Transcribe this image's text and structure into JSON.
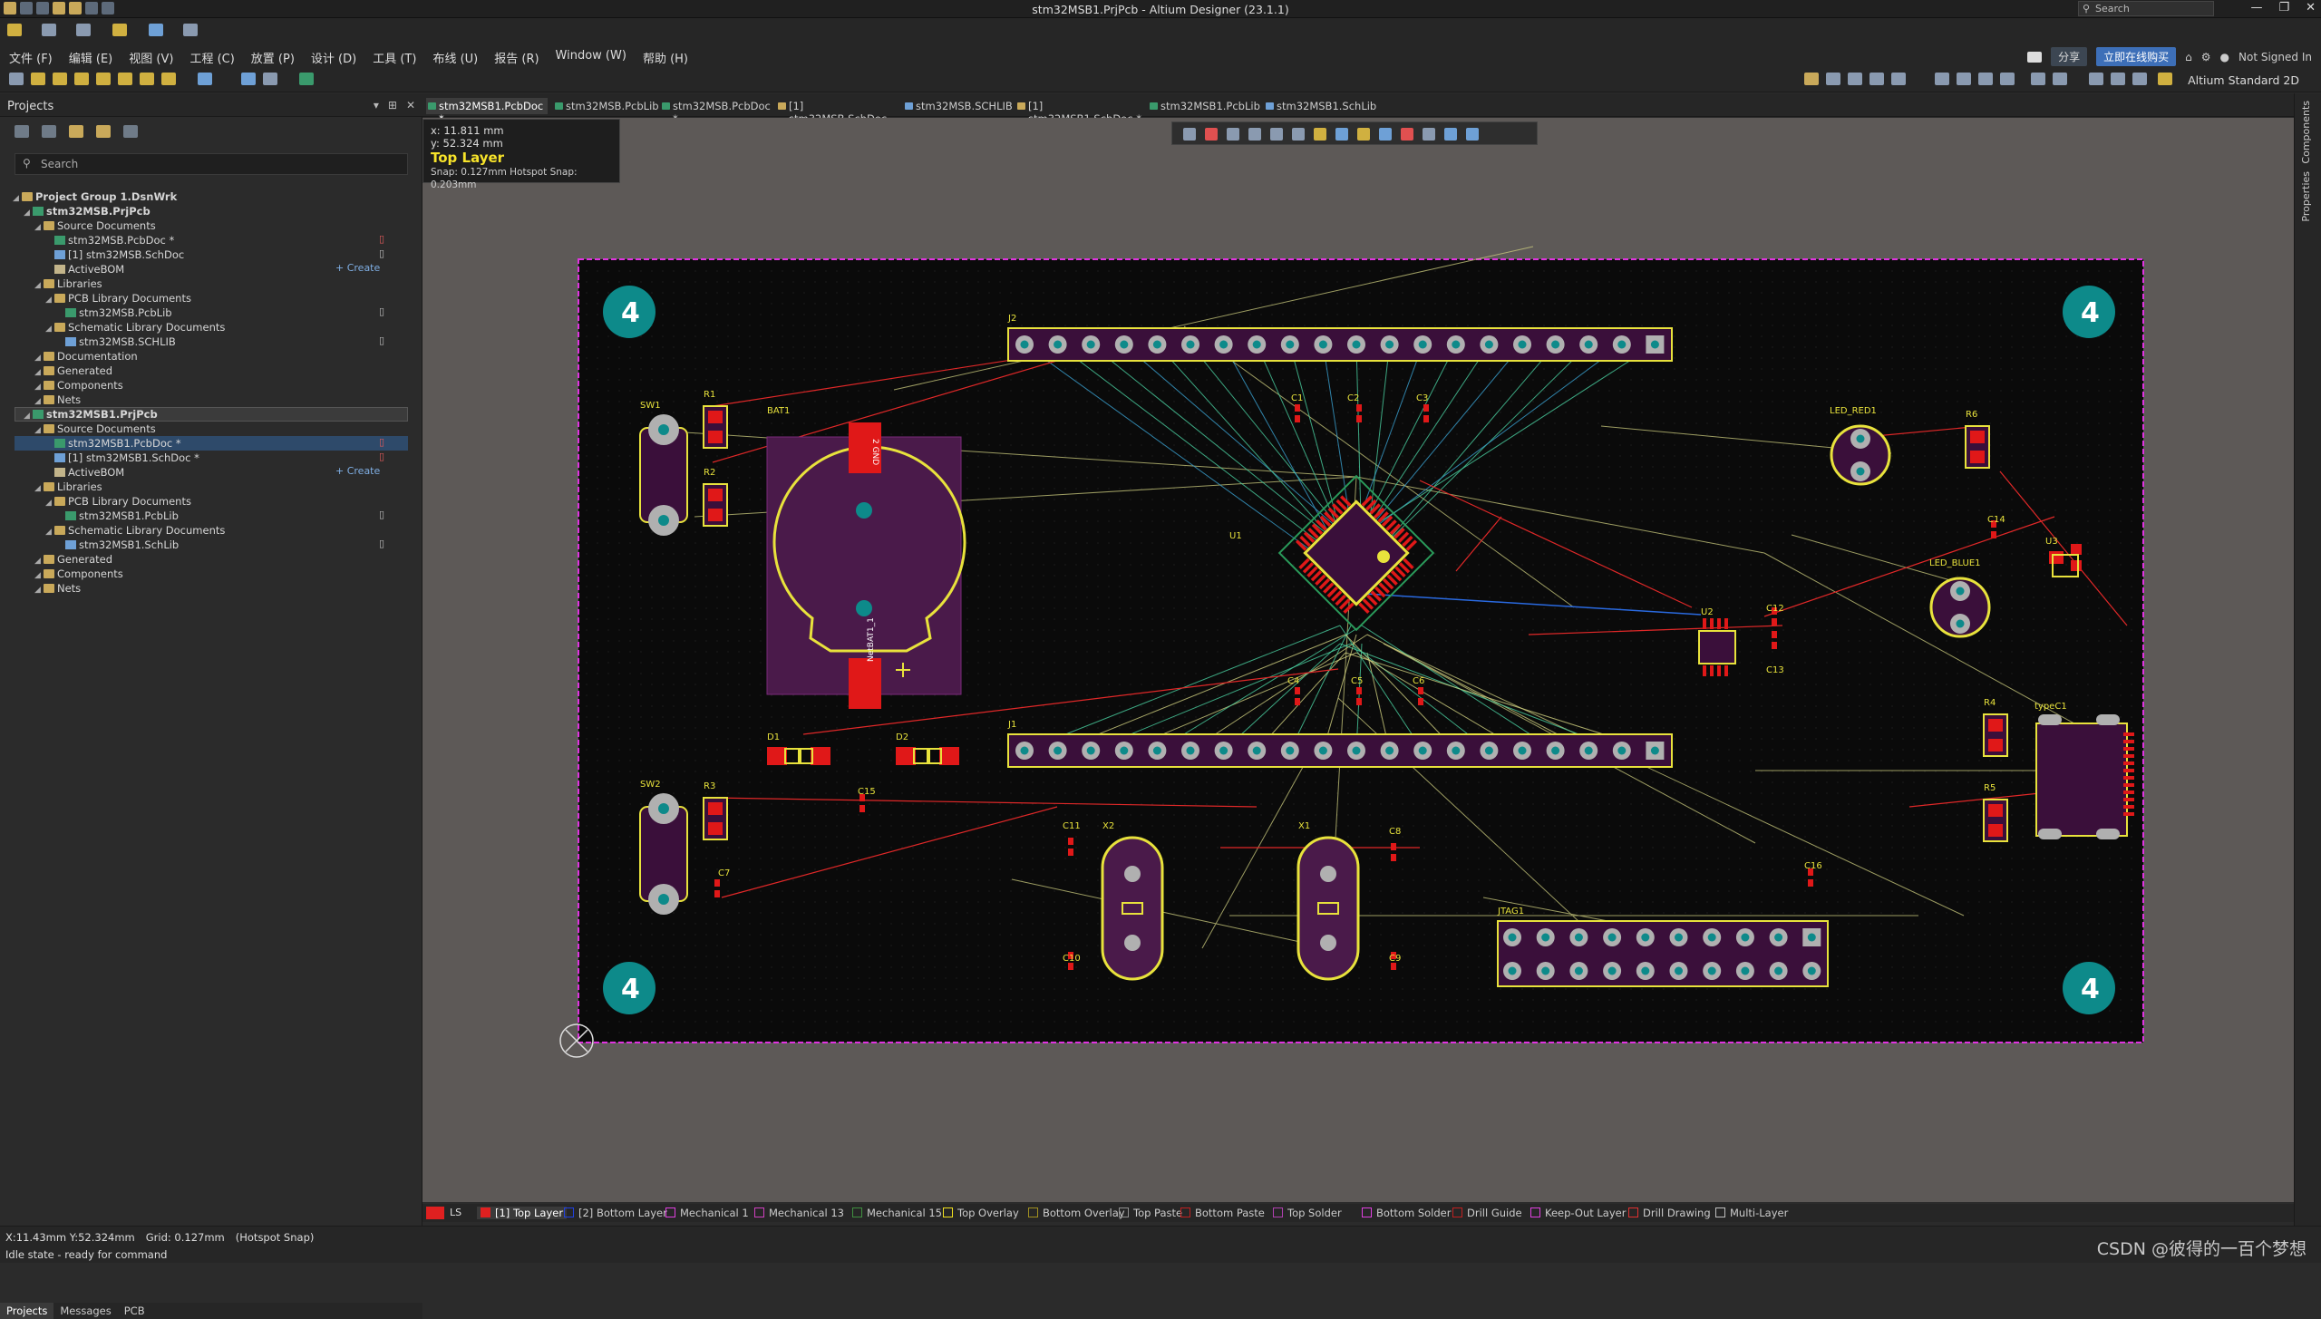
{
  "window": {
    "title": "stm32MSB1.PrjPcb - Altium Designer (23.1.1)",
    "search_placeholder": "Search",
    "minimize": "—",
    "restore": "❐",
    "close": "✕"
  },
  "menu": {
    "items": [
      "文件 (F)",
      "编辑 (E)",
      "视图 (V)",
      "工程 (C)",
      "放置 (P)",
      "设计 (D)",
      "工具 (T)",
      "布线 (U)",
      "报告 (R)",
      "Window (W)",
      "帮助 (H)"
    ],
    "share": "分享",
    "buy": "立即在线购买",
    "user": "Not Signed In"
  },
  "toolbar2": {
    "view_mode": "Altium Standard 2D"
  },
  "projects_panel": {
    "title": "Projects",
    "search_placeholder": "Search",
    "tree": [
      {
        "label": "Project Group 1.DsnWrk",
        "level": 0,
        "bold": true,
        "type": "group"
      },
      {
        "label": "stm32MSB.PrjPcb",
        "level": 1,
        "bold": true,
        "type": "project"
      },
      {
        "label": "Source Documents",
        "level": 2,
        "type": "folder"
      },
      {
        "label": "stm32MSB.PcbDoc *",
        "level": 3,
        "type": "pcb",
        "mark": "red"
      },
      {
        "label": "[1] stm32MSB.SchDoc",
        "level": 3,
        "type": "sch",
        "mark": "doc"
      },
      {
        "label": "ActiveBOM",
        "level": 3,
        "type": "bom",
        "create": "+ Create"
      },
      {
        "label": "Libraries",
        "level": 2,
        "type": "folder"
      },
      {
        "label": "PCB Library Documents",
        "level": 3,
        "type": "folder"
      },
      {
        "label": "stm32MSB.PcbLib",
        "level": 4,
        "type": "pcb",
        "mark": "doc"
      },
      {
        "label": "Schematic Library Documents",
        "level": 3,
        "type": "folder"
      },
      {
        "label": "stm32MSB.SCHLIB",
        "level": 4,
        "type": "sch",
        "mark": "doc"
      },
      {
        "label": "Documentation",
        "level": 2,
        "type": "folder"
      },
      {
        "label": "Generated",
        "level": 2,
        "type": "folder"
      },
      {
        "label": "Components",
        "level": 2,
        "type": "folder"
      },
      {
        "label": "Nets",
        "level": 2,
        "type": "folder"
      },
      {
        "label": "stm32MSB1.PrjPcb",
        "level": 1,
        "bold": true,
        "type": "project"
      },
      {
        "label": "Source Documents",
        "level": 2,
        "type": "folder"
      },
      {
        "label": "stm32MSB1.PcbDoc *",
        "level": 3,
        "type": "pcb",
        "mark": "red"
      },
      {
        "label": "[1] stm32MSB1.SchDoc *",
        "level": 3,
        "type": "sch",
        "mark": "red"
      },
      {
        "label": "ActiveBOM",
        "level": 3,
        "type": "bom",
        "create": "+ Create"
      },
      {
        "label": "Libraries",
        "level": 2,
        "type": "folder"
      },
      {
        "label": "PCB Library Documents",
        "level": 3,
        "type": "folder"
      },
      {
        "label": "stm32MSB1.PcbLib",
        "level": 4,
        "type": "pcb",
        "mark": "doc"
      },
      {
        "label": "Schematic Library Documents",
        "level": 3,
        "type": "folder"
      },
      {
        "label": "stm32MSB1.SchLib",
        "level": 4,
        "type": "sch",
        "mark": "doc"
      },
      {
        "label": "Generated",
        "level": 2,
        "type": "folder"
      },
      {
        "label": "Components",
        "level": 2,
        "type": "folder"
      },
      {
        "label": "Nets",
        "level": 2,
        "type": "folder"
      }
    ],
    "bottom_tabs": [
      "Projects",
      "Messages",
      "PCB"
    ]
  },
  "doc_tabs": [
    "stm32MSB1.PcbDoc *",
    "stm32MSB.PcbLib",
    "stm32MSB.PcbDoc *",
    "[1] stm32MSB.SchDoc",
    "stm32MSB.SCHLIB",
    "[1] stm32MSB1.SchDoc *",
    "stm32MSB1.PcbLib",
    "stm32MSB1.SchLib"
  ],
  "coord_box": {
    "x": "x: 11.811 mm",
    "y": "y: 52.324 mm",
    "layer": "Top Layer",
    "snap": "Snap: 0.127mm Hotspot Snap: 0.203mm"
  },
  "pcb": {
    "hole_label": "4",
    "components": {
      "J2": "J2",
      "J1": "J1",
      "SW1": "SW1",
      "SW2": "SW2",
      "BAT1": "BAT1",
      "R1": "R1",
      "R2": "R2",
      "R3": "R3",
      "R4": "R4",
      "R5": "R5",
      "R6": "R6",
      "U1": "U1",
      "U2": "U2",
      "U3": "U3",
      "C1": "C1",
      "C2": "C2",
      "C3": "C3",
      "C4": "C4",
      "C5": "C5",
      "C6": "C6",
      "C7": "C7",
      "C8": "C8",
      "C9": "C9",
      "C10": "C10",
      "C11": "C11",
      "C12": "C12",
      "C13": "C13",
      "C14": "C14",
      "C15": "C15",
      "C16": "C16",
      "D1": "D1",
      "D2": "D2",
      "X1": "X1",
      "X2": "X2",
      "LED_RED1": "LED_RED1",
      "LED_BLUE1": "LED_BLUE1",
      "typeC1": "typeC1",
      "JTAG1": "JTAG1"
    },
    "bat_pin_top": "2\nGND",
    "bat_pin_bottom": "NetBAT1_1"
  },
  "layer_tabs": {
    "ls": "LS",
    "layers": [
      {
        "name": "[1] Top Layer",
        "color": "#e02020",
        "active": true
      },
      {
        "name": "[2] Bottom Layer",
        "color": "#2040e0"
      },
      {
        "name": "Mechanical 1",
        "color": "#e040e0"
      },
      {
        "name": "Mechanical 13",
        "color": "#d040c0"
      },
      {
        "name": "Mechanical 15",
        "color": "#409040"
      },
      {
        "name": "Top Overlay",
        "color": "#f0e020"
      },
      {
        "name": "Bottom Overlay",
        "color": "#a09020"
      },
      {
        "name": "Top Paste",
        "color": "#909090"
      },
      {
        "name": "Bottom Paste",
        "color": "#c02020"
      },
      {
        "name": "Top Solder",
        "color": "#b040b0"
      },
      {
        "name": "Bottom Solder",
        "color": "#e040e0"
      },
      {
        "name": "Drill Guide",
        "color": "#c02020"
      },
      {
        "name": "Keep-Out Layer",
        "color": "#e040e0"
      },
      {
        "name": "Drill Drawing",
        "color": "#e03030"
      },
      {
        "name": "Multi-Layer",
        "color": "#c0c0c0"
      }
    ]
  },
  "status": {
    "coords": "X:11.43mm Y:52.324mm",
    "grid": "Grid: 0.127mm",
    "snap": "(Hotspot Snap)",
    "state": "Idle state - ready for command",
    "watermark": "CSDN @彼得的一百个梦想"
  },
  "right_panels": [
    "Components",
    "Properties"
  ]
}
